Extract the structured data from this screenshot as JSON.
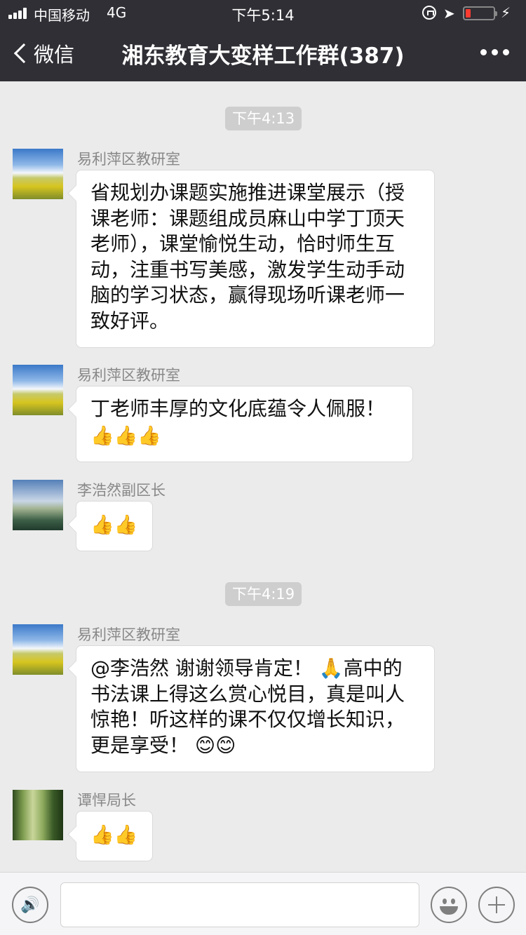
{
  "status_bar": {
    "carrier": "中国移动",
    "network": "4G",
    "time": "下午5:14"
  },
  "navbar": {
    "back_label": "微信",
    "title": "湘东教育大变样工作群(387)"
  },
  "chat": {
    "timestamps": [
      "下午4:13",
      "下午4:19"
    ],
    "messages": [
      {
        "sender": "易利萍区教研室",
        "avatar": "field-avatar",
        "text": "省规划办课题实施推进课堂展示（授课老师：课题组成员麻山中学丁顶天老师），课堂愉悦生动，恰时师生互动，注重书写美感，激发学生动手动脑的学习状态，赢得现场听课老师一致好评。",
        "emoji": ""
      },
      {
        "sender": "易利萍区教研室",
        "avatar": "field-avatar",
        "text": "丁老师丰厚的文化底蕴令人佩服！",
        "emoji": "👍👍👍"
      },
      {
        "sender": "李浩然副区长",
        "avatar": "mist-avatar",
        "text": "",
        "emoji": "👍👍"
      },
      {
        "sender": "易利萍区教研室",
        "avatar": "field-avatar",
        "text": "@李浩然 谢谢领导肯定！ 🙏高中的书法课上得这么赏心悦目，真是叫人惊艳！听这样的课不仅仅增长知识，更是享受！ 😊😊",
        "emoji": ""
      },
      {
        "sender": "谭悍局长",
        "avatar": "forest-avatar",
        "text": "",
        "emoji": "👍👍"
      }
    ]
  }
}
